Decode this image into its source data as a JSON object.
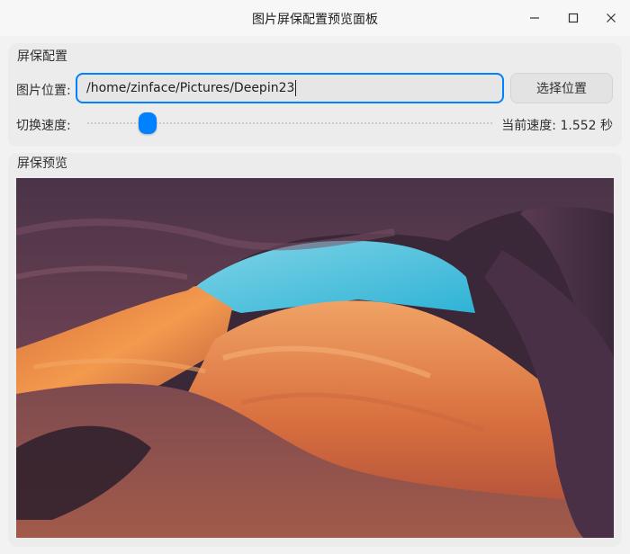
{
  "window": {
    "title": "图片屏保配置预览面板",
    "controls": {
      "minimize_icon": "minimize-icon",
      "maximize_icon": "maximize-icon",
      "close_icon": "close-icon"
    }
  },
  "config": {
    "section_title": "屏保配置",
    "path_label": "图片位置:",
    "path_value": "/home/zinface/Pictures/Deepin23",
    "choose_button": "选择位置",
    "speed_label": "切换速度:",
    "speed_slider_fraction": 0.15,
    "speed_readout": "当前速度: 1.552 秒"
  },
  "preview": {
    "section_title": "屏保预览"
  },
  "colors": {
    "accent": "#0081ff",
    "panel_bg": "#ececec",
    "window_bg": "#f2f2f2"
  }
}
